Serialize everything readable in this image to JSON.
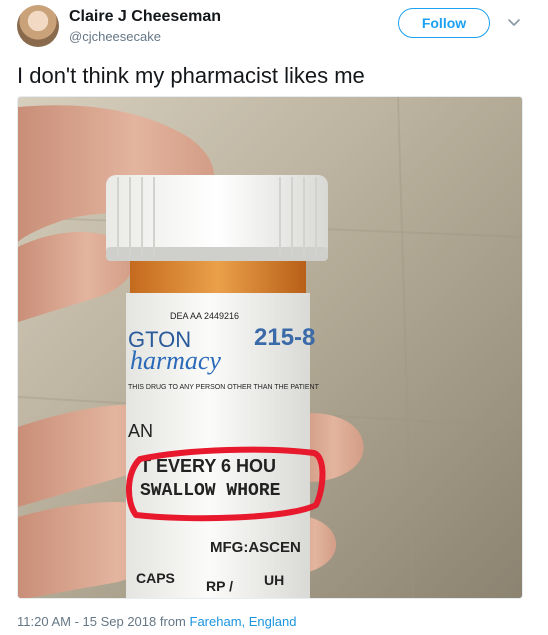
{
  "tweet": {
    "author": {
      "display_name": "Claire J Cheeseman",
      "handle": "@cjcheesecake"
    },
    "follow_label": "Follow",
    "text": "I don't think my pharmacist likes me",
    "timestamp": "11:20 AM - 15 Sep 2018",
    "from_label": "from",
    "location": "Fareham, England"
  },
  "photo": {
    "label_lines": {
      "dea": "DEA AA 2449216",
      "store_fragment": "GTON",
      "rx_number": "215-8",
      "pharmacy_script": "harmacy",
      "warning": "THIS DRUG TO ANY PERSON OTHER THAN THE PATIENT",
      "partial_line": "AN",
      "strike_line": "T EVERY 6 HOU",
      "highlighted_text": "SWALLOW WHORE",
      "mfg": "MFG:ASCEN",
      "caps": "CAPS",
      "rp": "RP /",
      "uh": "UH"
    },
    "circle_color": "#e8182d"
  },
  "colors": {
    "accent": "#1da1f2",
    "text": "#14171a",
    "secondary": "#657786",
    "link": "#1b95e0"
  }
}
